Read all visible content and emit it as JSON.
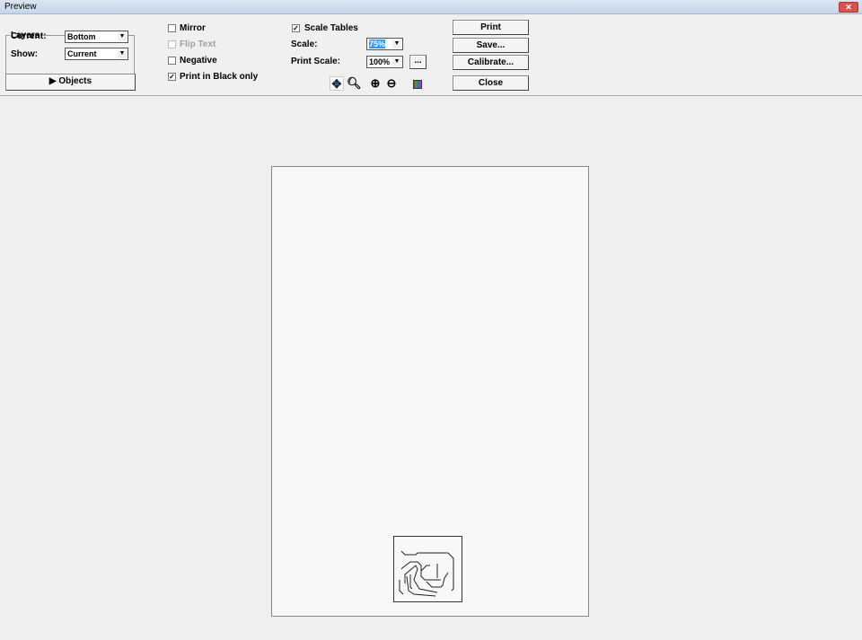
{
  "window": {
    "title": "Preview",
    "close": "✕"
  },
  "layers": {
    "legend": "Layers",
    "current_label": "Current:",
    "current_value": "Bottom",
    "show_label": "Show:",
    "show_value": "Current"
  },
  "objects_button": "▶ Objects",
  "options": {
    "mirror": "Mirror",
    "flip_text": "Flip Text",
    "negative": "Negative",
    "print_black": "Print in Black only",
    "scale_tables": "Scale Tables"
  },
  "checked": {
    "mirror": false,
    "flip_text": false,
    "negative": false,
    "print_black": true,
    "scale_tables": true
  },
  "scale": {
    "label": "Scale:",
    "value": "75%",
    "print_label": "Print Scale:",
    "print_value": "100%",
    "more": "..."
  },
  "buttons": {
    "print": "Print",
    "save": "Save...",
    "calibrate": "Calibrate...",
    "close": "Close"
  },
  "check_mark": "✓"
}
